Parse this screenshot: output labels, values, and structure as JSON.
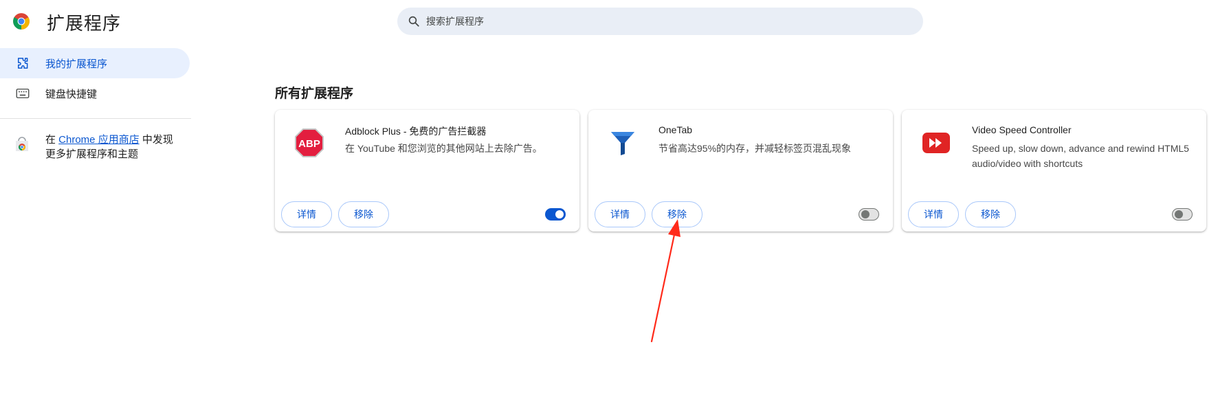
{
  "header": {
    "title": "扩展程序",
    "logo_icon": "chrome-logo-icon"
  },
  "search": {
    "placeholder": "搜索扩展程序",
    "value": ""
  },
  "sidebar": {
    "items": [
      {
        "label": "我的扩展程序",
        "icon": "puzzle-icon",
        "active": true
      },
      {
        "label": "键盘快捷键",
        "icon": "keyboard-icon",
        "active": false
      }
    ],
    "store_promo": {
      "prefix": "在 ",
      "link": "Chrome 应用商店",
      "suffix": " 中发现更多扩展程序和主题",
      "icon": "chrome-web-store-icon"
    }
  },
  "main": {
    "section_title": "所有扩展程序",
    "extensions": [
      {
        "name": "Adblock Plus - 免费的广告拦截器",
        "description": "在 YouTube 和您浏览的其他网站上去除广告。",
        "icon": "abp-icon",
        "details_label": "详情",
        "remove_label": "移除",
        "enabled": true,
        "icon_text": "ABP"
      },
      {
        "name": "OneTab",
        "description": "节省高达95%的内存，并减轻标签页混乱现象",
        "icon": "onetab-funnel-icon",
        "details_label": "详情",
        "remove_label": "移除",
        "enabled": false
      },
      {
        "name": "Video Speed Controller",
        "description": "Speed up, slow down, advance and rewind HTML5 audio/video with shortcuts",
        "icon": "fast-forward-icon",
        "details_label": "详情",
        "remove_label": "移除",
        "enabled": false
      }
    ]
  },
  "colors": {
    "accent": "#0b57d0",
    "active_nav_bg": "#e8f0fe",
    "search_bg": "#e9eef6",
    "abp_red": "#e31e3f",
    "onetab_blue": "#1d5fb8",
    "vsc_red": "#e02424",
    "annotation_arrow": "#ff2a1a"
  }
}
